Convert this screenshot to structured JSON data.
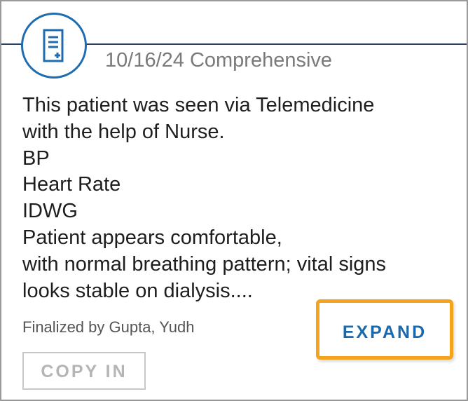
{
  "note": {
    "date_title": "10/16/24 Comprehensive",
    "icon": "note-document-plus-icon",
    "body_lines": [
      "This patient was seen via Telemedicine",
      "with the help of Nurse.",
      "BP",
      "Heart Rate",
      "IDWG",
      "Patient appears comfortable,",
      "with normal breathing pattern; vital signs",
      "looks stable on dialysis...."
    ],
    "finalized_by": "Finalized by Gupta, Yudh"
  },
  "actions": {
    "expand_label": "EXPAND",
    "copy_in_label": "COPY IN"
  },
  "colors": {
    "accent_blue": "#1a69ad",
    "highlight_orange": "#f3a31c",
    "header_rule": "#2c3e63"
  }
}
